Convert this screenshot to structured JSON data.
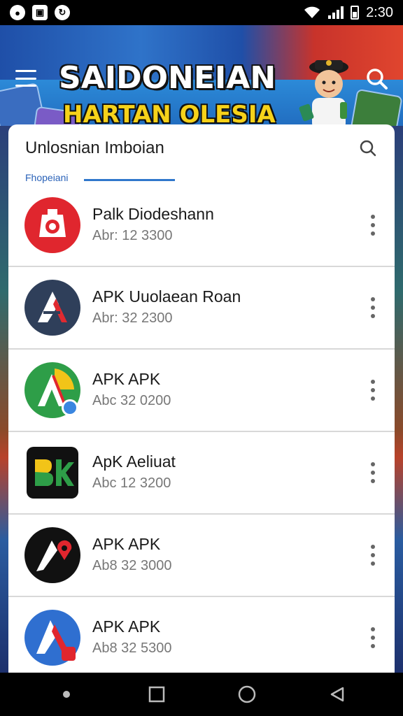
{
  "status_bar": {
    "time": "2:30",
    "left_icons": [
      "circle-icon",
      "square-icon",
      "sync-icon"
    ],
    "right_icons": [
      "wifi-icon",
      "signal-icon",
      "battery-icon"
    ]
  },
  "banner": {
    "title_line_1": "SAIDONEIAN",
    "title_line_2": "HARTAN OLESIA",
    "colors": {
      "blue": "#1f4fa8",
      "red": "#c8332b",
      "yellow": "#f6d21a"
    }
  },
  "card": {
    "title": "Unlosnian Imboian",
    "tab_label": "Fhopeiani",
    "accent": "#3077cc"
  },
  "apps": [
    {
      "title": "Palk Diodeshann",
      "subtitle": "Abr: 12 3300",
      "icon": "red-gear-icon"
    },
    {
      "title": "APK Uuolaean Roan",
      "subtitle": "Abr: 32 2300",
      "icon": "navy-a-icon"
    },
    {
      "title": "APK APK",
      "subtitle": "Abc 32 0200",
      "icon": "green-a-icon"
    },
    {
      "title": "ApK Aeliuat",
      "subtitle": "Abc 12 3200",
      "icon": "bk-icon"
    },
    {
      "title": "APK APK",
      "subtitle": "Ab8 32 3000",
      "icon": "black-pin-icon"
    },
    {
      "title": "APK APK",
      "subtitle": "Ab8 32 5300",
      "icon": "blue-a-icon"
    }
  ],
  "nav_bar": {
    "buttons": [
      "dot-icon",
      "recents-icon",
      "home-icon",
      "back-icon"
    ]
  }
}
